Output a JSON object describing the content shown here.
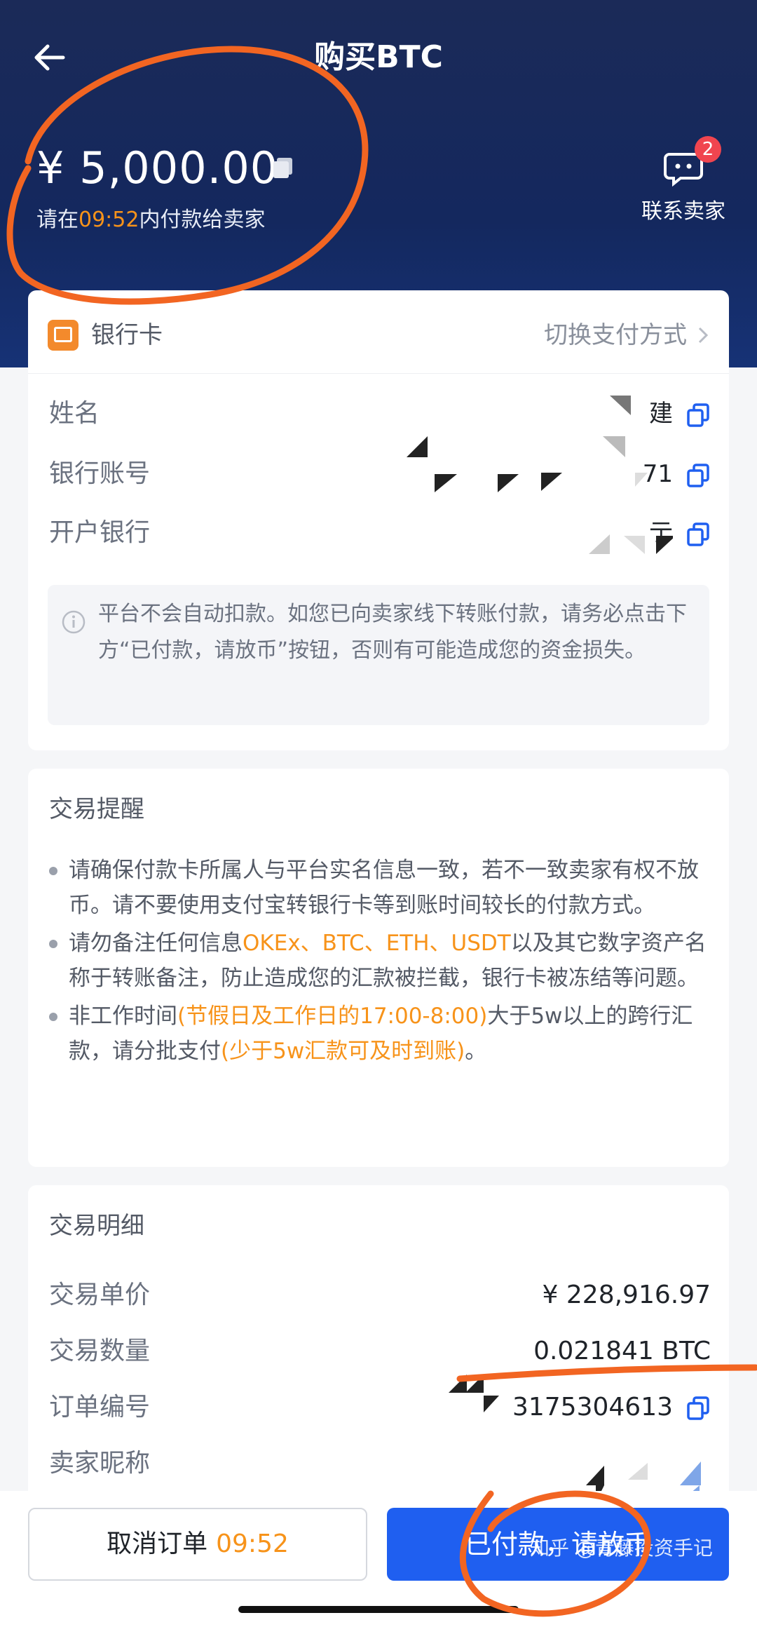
{
  "header": {
    "title": "购买BTC",
    "amount": "¥ 5,000.00",
    "deadline_prefix": "请在",
    "deadline_timer": "09:52",
    "deadline_suffix": "内付款给卖家",
    "contact_label": "联系卖家",
    "contact_badge": "2"
  },
  "payment": {
    "method_label": "银行卡",
    "switch_label": "切换支付方式",
    "rows": [
      {
        "label": "姓名",
        "value": "建"
      },
      {
        "label": "银行账号",
        "value": "71"
      },
      {
        "label": "开户银行",
        "value": "亍"
      }
    ],
    "notice": "平台不会自动扣款。如您已向卖家线下转账付款，请务必点击下方“已付款，请放币”按钮，否则有可能造成您的资金损失。"
  },
  "reminder": {
    "title": "交易提醒",
    "tip1": "请确保付款卡所属人与平台实名信息一致，若不一致卖家有权不放币。请不要使用支付宝转银行卡等到账时间较长的付款方式。",
    "tip2_a": "请勿备注任何信息",
    "tip2_hl": "OKEx、BTC、ETH、USDT",
    "tip2_b": "以及其它数字资产名称于转账备注，防止造成您的汇款被拦截，银行卡被冻结等问题。",
    "tip3_a": "非工作时间",
    "tip3_hl1": "(节假日及工作日的17:00-8:00)",
    "tip3_b": "大于5w以上的跨行汇款，请分批支付",
    "tip3_hl2": "(少于5w汇款可及时到账)",
    "tip3_c": "。"
  },
  "details": {
    "title": "交易明细",
    "unit_price_label": "交易单价",
    "unit_price": "¥ 228,916.97",
    "quantity_label": "交易数量",
    "quantity": "0.021841 BTC",
    "order_no_label": "订单编号",
    "order_no": "3175304613",
    "seller_label": "卖家昵称",
    "seller": ""
  },
  "actions": {
    "cancel_label": "取消订单",
    "cancel_timer": "09:52",
    "paid_label": "已付款，请放币"
  },
  "watermark": "知乎 @青藤投资手记",
  "colors": {
    "accent": "#1f5ff0",
    "highlight": "#f7931a",
    "annotation": "#f26522"
  },
  "icons": [
    "back-arrow-icon",
    "copy-icon",
    "chat-icon",
    "bank-card-icon",
    "chevron-right-icon",
    "info-icon"
  ]
}
